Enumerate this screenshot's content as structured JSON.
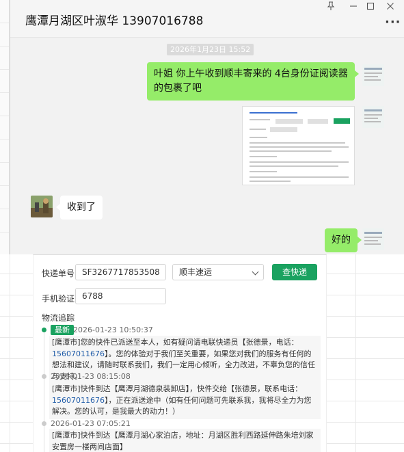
{
  "chat": {
    "title": "鹰潭月湖区叶淑华 13907016788",
    "window_buttons": [
      "pin-icon",
      "minimize-icon",
      "maximize-icon",
      "close-icon"
    ],
    "more_icon": "more-icon",
    "timestamp": "2026年1月23日 15:52",
    "messages": [
      {
        "from": "me",
        "text": "叶姐  你上午收到顺丰寄来的 4台身份证阅读器的包裹了吧"
      },
      {
        "from": "me",
        "type": "image"
      },
      {
        "from": "them",
        "text": "收到了"
      },
      {
        "from": "me",
        "text": "好的"
      }
    ]
  },
  "tracking": {
    "waybill_label": "快递单号:",
    "waybill_value": "SF3267717853508",
    "carrier_value": "顺丰速运",
    "query_button": "查快递",
    "phone_label": "手机验证:",
    "phone_value": "6788",
    "section_title": "物流追踪",
    "latest_tag": "最新",
    "events": [
      {
        "time": "2026-01-23 10:50:37",
        "text_a": "[鹰潭市]您的快件已派送至本人，如有疑问请电联快递员【张德景，电话：",
        "phone": "15607011676",
        "text_b": "】。您的体验对于我们至关重要，如果您对我们的服务有任何的想法和建议，请随时联系我们，我们一定用心倾听，全力改进，不辜负您的信任与支持。"
      },
      {
        "time": "2026-01-23 08:15:08",
        "text_a": "[鹰潭市]快件到达【鹰潭月湖德泉装卸店】，快件交给【张德景，联系电话：",
        "phone": "15607011676",
        "text_b": "】，正在派送途中（如有任何问题可先联系我，我将尽全力为您解决。您的认可，是我最大的动力！）"
      },
      {
        "time": "2026-01-23 07:05:21",
        "text_a": "[鹰潭市]快件到达【鹰潭月湖心家泊店，地址：月湖区胜利西路延伸路朱培刘家安置房一楼两间店面】",
        "phone": "",
        "text_b": ""
      }
    ]
  }
}
